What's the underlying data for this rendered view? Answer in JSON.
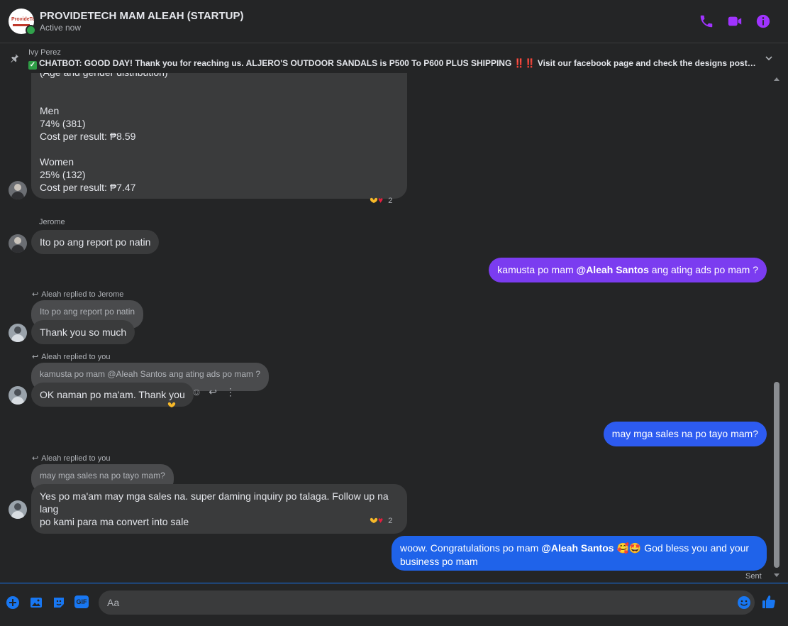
{
  "header": {
    "title": "PROVIDETECH MAM ALEAH (STARTUP)",
    "status": "Active now",
    "logo_text": "ProvideTech",
    "accent_color": "#a033ff",
    "icons": [
      "phone-icon",
      "video-call-icon",
      "info-icon"
    ]
  },
  "pinned": {
    "sender": "Ivy Perez",
    "check": "✓",
    "text": "CHATBOT: GOOD DAY! Thank you for reaching us. ALJERO'S OUTDOOR SANDALS is P500 To P600 PLUS SHIPPING ‼️‼️ Visit our facebook page and check the designs posted 👇 https://www...."
  },
  "messages": {
    "m1": {
      "lines": [
        "(Age and gender distribution)",
        "",
        "",
        "Men",
        "74% (381)",
        "Cost per result: ₱8.59",
        "",
        "Women",
        "25% (132)",
        "Cost per result: ₱7.47"
      ],
      "reaction_count": "2"
    },
    "m2": {
      "sender": "Jerome",
      "text": "Ito po ang report po natin"
    },
    "m3": {
      "text_before": "kamusta po mam ",
      "mention": "@Aleah Santos",
      "text_after": " ang ating ads po mam ?"
    },
    "m4": {
      "reply_label": "Aleah replied to Jerome",
      "quote": "Ito po ang report po natin",
      "text": "Thank you so much"
    },
    "m5": {
      "reply_label": "Aleah replied to you",
      "quote": "kamusta po mam @Aleah Santos ang ating ads po mam ?",
      "text": "OK naman po ma'am. Thank you"
    },
    "m6": {
      "text": "may mga sales na po tayo mam?"
    },
    "m7": {
      "reply_label": "Aleah replied to you",
      "quote": "may mga sales na po tayo mam?",
      "lines": [
        "Yes po ma'am may mga sales na. super daming inquiry po talaga. Follow up na lang",
        "po kami para ma convert into sale"
      ],
      "reaction_count": "2"
    },
    "m8": {
      "line1_before": "woow. Congratulations po mam ",
      "mention": "@Aleah Santos",
      "line1_after": " 🥰🤩 God bless you and your",
      "line2": "business po mam",
      "sent_label": "Sent"
    }
  },
  "composer": {
    "placeholder": "Aa",
    "icons": [
      "plus-icon",
      "image-icon",
      "sticker-icon",
      "gif-icon",
      "emoji-icon",
      "like-icon"
    ],
    "gif_label": "GIF"
  },
  "colors": {
    "background": "#242526",
    "bubble_in": "#3a3b3c",
    "bubble_out_purple": "#7b3cf0",
    "bubble_out_blue": "#1f63ea",
    "icon_blue": "#1877f2"
  }
}
